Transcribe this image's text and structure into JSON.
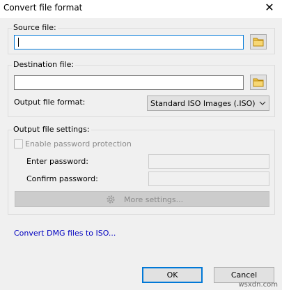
{
  "window": {
    "title": "Convert file format",
    "close_glyph": "✕"
  },
  "source": {
    "group_label": "Source file:",
    "value": ""
  },
  "destination": {
    "group_label": "Destination file:",
    "value": "",
    "format_label": "Output file format:",
    "format_selected": "Standard ISO Images (.ISO)"
  },
  "settings": {
    "group_label": "Output file settings:",
    "password_checkbox_label": "Enable password protection",
    "password_checked": false,
    "enter_password_label": "Enter password:",
    "confirm_password_label": "Confirm password:",
    "more_settings_label": "More settings..."
  },
  "links": {
    "convert_dmg": "Convert DMG files to ISO..."
  },
  "buttons": {
    "ok": "OK",
    "cancel": "Cancel"
  },
  "watermark": "wsxdn.com",
  "colors": {
    "accent": "#0078d7",
    "link": "#0000c0",
    "folder": "#f2c94c"
  }
}
